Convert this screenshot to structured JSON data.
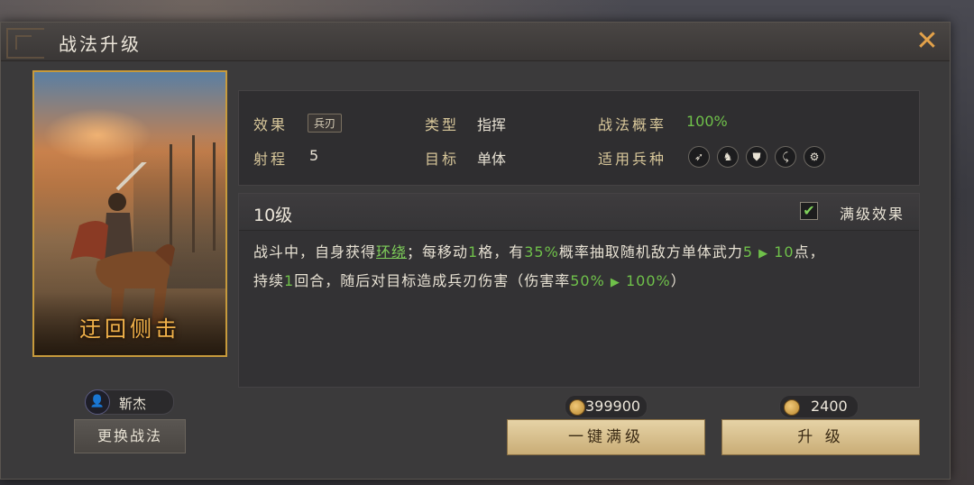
{
  "dialog": {
    "title": "战法升级",
    "close_label": "✕"
  },
  "card": {
    "name": "迂回侧击"
  },
  "owner": {
    "avatar_label": "👤",
    "name": "靳杰"
  },
  "swap_button": "更换战法",
  "info": {
    "effect_label": "效果",
    "effect_tag": "兵刃",
    "type_label": "类型",
    "type_value": "指挥",
    "rate_label": "战法概率",
    "rate_value": "100%",
    "range_label": "射程",
    "range_value": "5",
    "target_label": "目标",
    "target_value": "单体",
    "troops_label": "适用兵种",
    "troops": [
      {
        "icon": "spear-icon",
        "glyph": "➶"
      },
      {
        "icon": "horse-icon",
        "glyph": "♞"
      },
      {
        "icon": "shield-icon",
        "glyph": "⛊"
      },
      {
        "icon": "bow-icon",
        "glyph": "⤹"
      },
      {
        "icon": "chariot-icon",
        "glyph": "⚙"
      }
    ]
  },
  "level": {
    "title": "10级",
    "max_label": "满级效果",
    "max_checked": true,
    "desc": {
      "p1": "战斗中，自身获得",
      "link": "环绕",
      "p2": "；每移动",
      "n1": "1",
      "p3": "格，有",
      "n2": "35%",
      "p4": "概率抽取随机敌方单体武力",
      "n3": "5",
      "n4": "10",
      "p5": "点，",
      "p6": "持续",
      "n5": "1",
      "p7": "回合，随后对目标造成兵刃伤害（伤害率",
      "n6": "50%",
      "n7": "100%",
      "p8": "）"
    }
  },
  "costs": {
    "max_cost": "399900",
    "upgrade_cost": "2400"
  },
  "buttons": {
    "max_level": "一键满级",
    "upgrade": "升 级"
  },
  "colors": {
    "accent": "#e3a24a",
    "green": "#6fc04a",
    "button": "#d9c18c"
  }
}
